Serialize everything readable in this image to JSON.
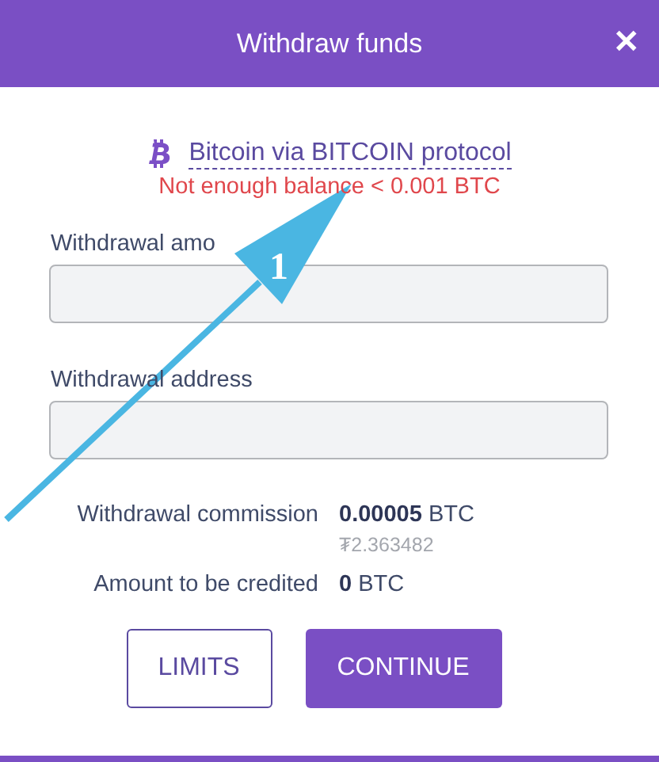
{
  "window": {
    "title": "Withdraw funds",
    "close": "✕"
  },
  "method": {
    "label": "Bitcoin via BITCOIN protocol",
    "error": "Not enough balance < 0.001 BTC"
  },
  "fields": [
    {
      "label": "Withdrawal amo"
    },
    {
      "label": "Withdrawal address"
    }
  ],
  "summary": [
    {
      "label": "Withdrawal commission",
      "value": "**0.00005** BTC",
      "sub": "₮2.363482"
    },
    {
      "label": "Amount to be credited",
      "value": "**0** BTC"
    }
  ],
  "buttons": [
    {
      "label": "LIMITS",
      "kind": "outline"
    },
    {
      "label": "CONTINUE",
      "kind": "primary"
    }
  ],
  "annotation": {
    "label": "1"
  }
}
